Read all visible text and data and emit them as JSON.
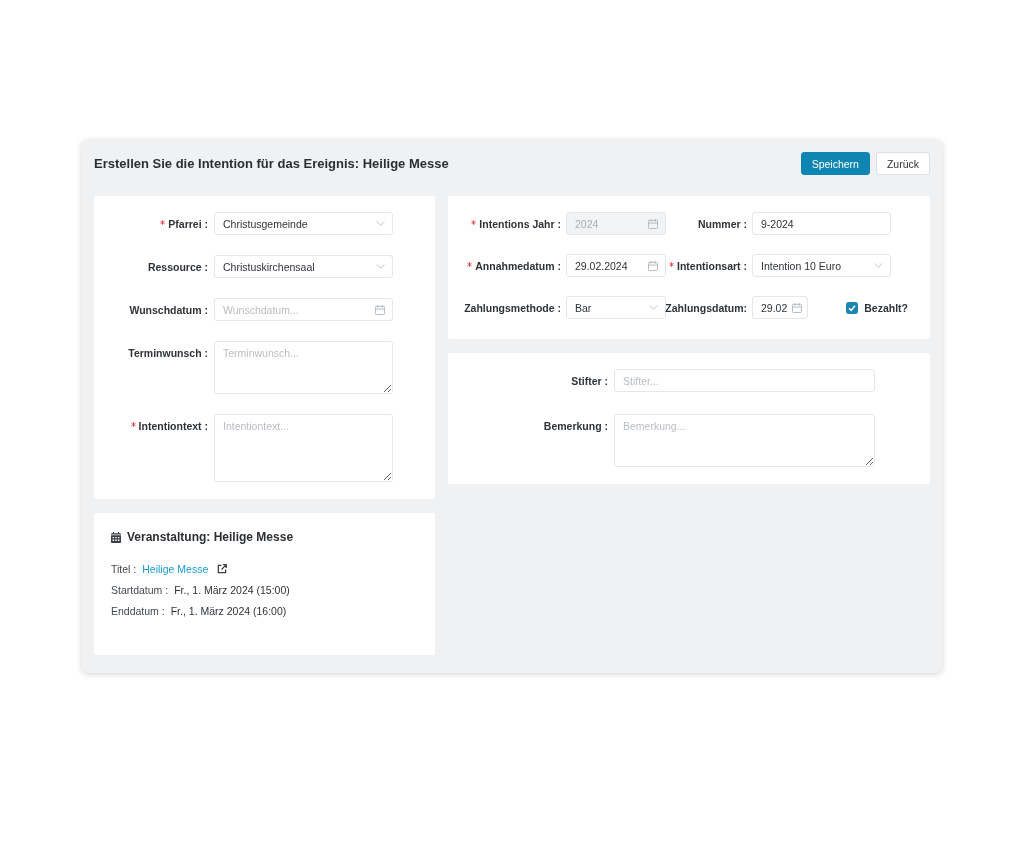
{
  "header": {
    "title": "Erstellen Sie die Intention für das Ereignis: Heilige Messe",
    "buttons": [
      {
        "label": "Speichern",
        "kind": "primary"
      },
      {
        "label": "Zurück",
        "kind": "secondary"
      }
    ]
  },
  "intention_form": {
    "fields": [
      {
        "kind": "select",
        "label": "Pfarrei :",
        "required": true,
        "value": "Christusgemeinde"
      },
      {
        "kind": "select",
        "label": "Ressource :",
        "required": false,
        "value": "Christuskirchensaal"
      },
      {
        "kind": "date",
        "label": "Wunschdatum :",
        "required": false,
        "placeholder": "Wunschdatum..."
      },
      {
        "kind": "textarea",
        "label": "Terminwunsch :",
        "required": false,
        "placeholder": "Terminwunsch..."
      },
      {
        "kind": "textarea",
        "label": "Intentiontext :",
        "required": true,
        "placeholder": "Intentiontext..."
      }
    ]
  },
  "payment": {
    "rows": [
      [
        {
          "kind": "date",
          "label": "Intentions Jahr :",
          "required": true,
          "disabled": true,
          "value": "2024"
        },
        {
          "kind": "text",
          "label": "Nummer :",
          "required": false,
          "disabled": false,
          "value": "9-2024"
        }
      ],
      [
        {
          "kind": "date",
          "label": "Annahmedatum :",
          "required": true,
          "disabled": false,
          "value": "29.02.2024"
        },
        {
          "kind": "select",
          "label": "Intentionsart :",
          "required": true,
          "disabled": false,
          "value": "Intention 10 Euro"
        }
      ],
      [
        {
          "kind": "select",
          "label": "Zahlungsmethode :",
          "required": false,
          "disabled": false,
          "value": "Bar"
        },
        {
          "kind": "date",
          "label": "Zahlungsdatum:",
          "required": false,
          "disabled": false,
          "value": "29.02"
        },
        {
          "kind": "checkbox",
          "label": "Bezahlt?",
          "checked": true
        }
      ]
    ]
  },
  "donor": {
    "fields": [
      {
        "kind": "text",
        "label": "Stifter :",
        "required": false,
        "placeholder": "Stifter..."
      },
      {
        "kind": "textarea",
        "label": "Bemerkung :",
        "required": false,
        "placeholder": "Bemerkung..."
      }
    ]
  },
  "event": {
    "title": "Veranstaltung: Heilige Messe",
    "details": [
      {
        "kind": "link",
        "label": "Titel :",
        "value": "Heilige Messe"
      },
      {
        "kind": "text",
        "label": "Startdatum :",
        "value": "Fr., 1. März 2024 (15:00)"
      },
      {
        "kind": "text",
        "label": "Enddatum :",
        "value": "Fr., 1. März 2024 (16:00)"
      }
    ]
  }
}
